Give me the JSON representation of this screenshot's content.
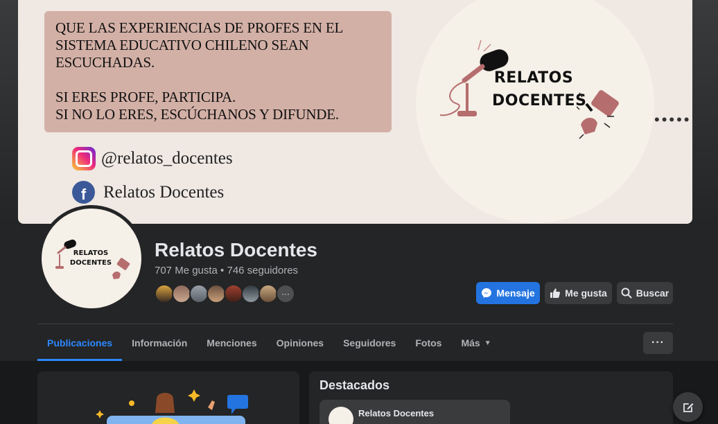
{
  "cover": {
    "lines": [
      "QUE LAS EXPERIENCIAS DE PROFES EN EL",
      "SISTEMA EDUCATIVO CHILENO SEAN",
      "ESCUCHADAS.",
      "SI ERES PROFE, PARTICIPA.",
      "SI NO LO ERES, ESCÚCHANOS Y DIFUNDE."
    ],
    "instagram_handle": "@relatos_docentes",
    "facebook_name": "Relatos Docentes",
    "logo_line1": "RELATOS",
    "logo_line2": "DOCENTES"
  },
  "profile": {
    "name": "Relatos Docentes",
    "stats": "707 Me gusta • 746 seguidores",
    "avatar_line1": "RELATOS",
    "avatar_line2": "DOCENTES",
    "follower_more": "···"
  },
  "actions": {
    "message": "Mensaje",
    "like": "Me gusta",
    "search": "Buscar"
  },
  "tabs": [
    "Publicaciones",
    "Información",
    "Menciones",
    "Opiniones",
    "Seguidores",
    "Fotos",
    "Más"
  ],
  "tab_more_glyph": "···",
  "featured": {
    "title": "Destacados",
    "post_name": "Relatos Docentes"
  },
  "colors": {
    "accent": "#2d88ff",
    "primary_button": "#2374e1",
    "surface": "#242526",
    "background": "#18191a"
  }
}
